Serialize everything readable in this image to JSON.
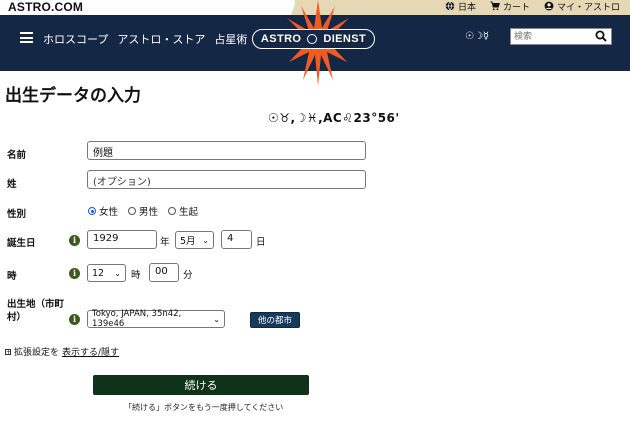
{
  "header": {
    "brand": "ASTRO.COM",
    "top_links": [
      {
        "icon": "globe-icon",
        "label": "日本"
      },
      {
        "icon": "cart-icon",
        "label": "カート"
      },
      {
        "icon": "user-icon",
        "label": "マイ・アストロ"
      }
    ]
  },
  "nav": {
    "links": [
      "ホロスコープ",
      "アストロ・ストア",
      "占星術"
    ],
    "logo_left": "ASTRO",
    "logo_right": "DIENST",
    "planets": "☉☽☿",
    "search_placeholder": "検索"
  },
  "form": {
    "title": "出生データの入力",
    "chart_symbols": "☉♉,☽♓,AC♌23°56'",
    "name": {
      "label": "名前",
      "value": "例題"
    },
    "surname": {
      "label": "姓",
      "placeholder": "(オプション)"
    },
    "gender": {
      "label": "性別",
      "options": [
        "女性",
        "男性",
        "生起"
      ],
      "selected": "女性"
    },
    "birth_date": {
      "label": "誕生日",
      "year": "1929",
      "year_unit": "年",
      "month": "5月",
      "day": "4",
      "day_unit": "日"
    },
    "time": {
      "label": "時",
      "hour": "12",
      "hour_unit": "時",
      "minute": "00",
      "minute_unit": "分"
    },
    "birthplace": {
      "label": "出生地（市町村）",
      "value": "Tokyo, JAPAN, 35n42, 139e46",
      "other_button": "他の都市"
    },
    "advanced_prefix": "拡張設定を",
    "advanced_link": "表示する/隠す",
    "continue_button": "続ける",
    "continue_hint": "「続ける」ボタンをもう一度押してください"
  },
  "colors": {
    "nav_bg": "#142744",
    "top_tan": "#e6d8b5",
    "continue_bg": "#0f3318",
    "other_btn": "#163a5a",
    "info_icon": "#3b5a1e",
    "burst": "#f15a22"
  }
}
